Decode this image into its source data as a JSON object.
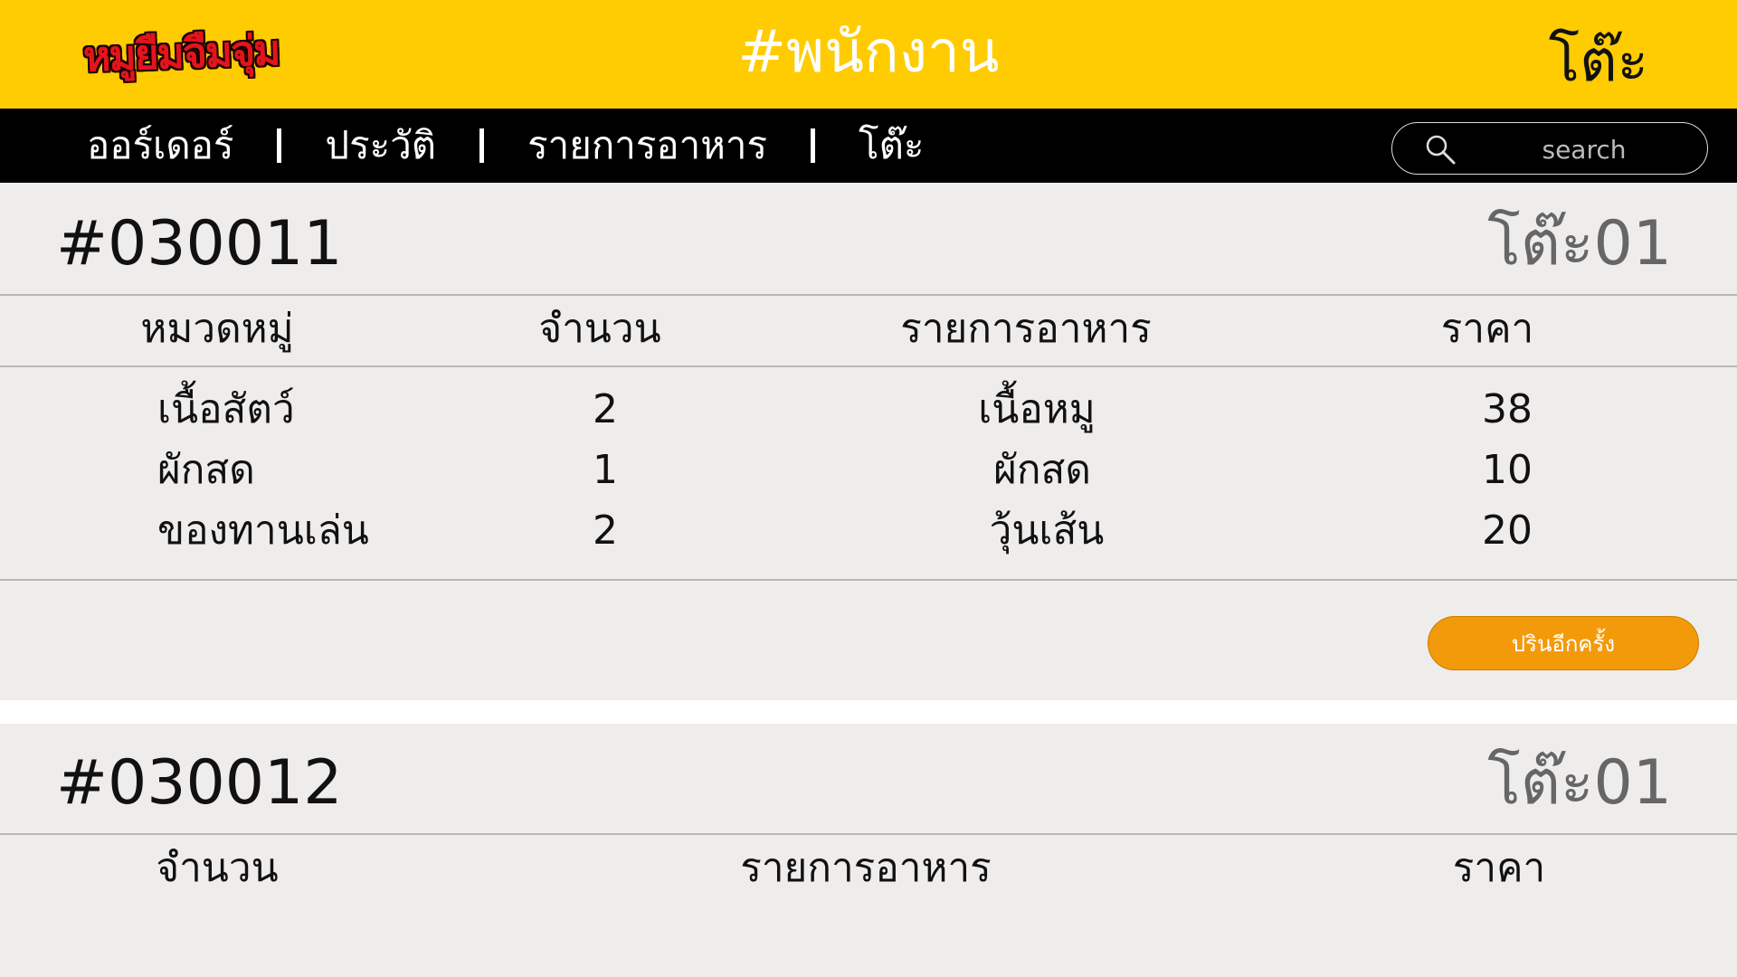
{
  "header": {
    "logo_text": "หมูยืมจืมจุ่ม",
    "title": "#พนักงาน",
    "right_label": "โต๊ะ"
  },
  "nav": {
    "items": [
      "ออร์เดอร์",
      "ประวัติ",
      "รายการอาหาร",
      "โต๊ะ"
    ],
    "search_placeholder": "search"
  },
  "orders": [
    {
      "id": "#030011",
      "table": "โต๊ะ01",
      "columns": [
        "หมวดหมู่",
        "จำนวน",
        "รายการอาหาร",
        "ราคา"
      ],
      "rows": [
        [
          "เนื้อสัตว์",
          "2",
          "เนื้อหมู",
          "38"
        ],
        [
          "ผักสด",
          "1",
          "ผักสด",
          "10"
        ],
        [
          "ของทานเล่น",
          "2",
          "วุ้นเส้น",
          "20"
        ]
      ],
      "action_label": "ปรินอีกครั้ง"
    },
    {
      "id": "#030012",
      "table": "โต๊ะ01",
      "columns": [
        "จำนวน",
        "รายการอาหาร",
        "ราคา"
      ]
    }
  ],
  "colors": {
    "header_bg": "#fecc00",
    "nav_bg": "#000000",
    "card_bg": "#efedec",
    "button_bg": "#f39a0b"
  }
}
